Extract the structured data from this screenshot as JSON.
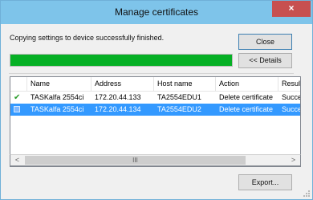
{
  "window": {
    "title": "Manage certificates",
    "close_glyph": "×"
  },
  "message": "Copying settings to device successfully finished.",
  "buttons": {
    "close": "Close",
    "details": "<< Details",
    "export": "Export..."
  },
  "progress": {
    "percent": 100,
    "color": "#06b025"
  },
  "table": {
    "columns": [
      "Name",
      "Address",
      "Host name",
      "Action",
      "Result"
    ],
    "rows": [
      {
        "status_icon": "check-icon",
        "name": "TASKalfa 2554ci",
        "address": "172.20.44.133",
        "host": "TA2554EDU1",
        "action": "Delete certificate",
        "result": "Succee",
        "selected": false
      },
      {
        "status_icon": "check-icon",
        "name": "TASKalfa 2554ci",
        "address": "172.20.44.134",
        "host": "TA2554EDU2",
        "action": "Delete certificate",
        "result": "Succee",
        "selected": true
      }
    ]
  },
  "scrollbar": {
    "left_glyph": "<",
    "right_glyph": ">",
    "thumb_glyph": "III"
  },
  "colors": {
    "titlebar": "#7ec4ea",
    "selection": "#3399ff",
    "close_button": "#c75050"
  }
}
